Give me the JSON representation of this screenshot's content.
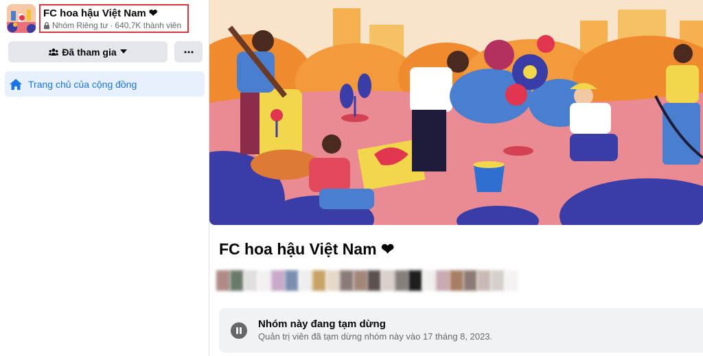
{
  "group": {
    "name": "FC hoa hậu Việt Nam ❤",
    "privacy": "Nhóm Riêng tư",
    "separator": "·",
    "members": "640,7K thành viên"
  },
  "actions": {
    "joined_label": "Đã tham gia",
    "more_label": "···"
  },
  "nav": {
    "home_label": "Trang chủ của cộng đồng"
  },
  "main": {
    "title": "FC hoa hậu Việt Nam ❤",
    "notice_title": "Nhóm này đang tạm dừng",
    "notice_desc": "Quản trị viên đã tạm dừng nhóm này vào 17 tháng 8, 2023."
  },
  "colors": {
    "accent": "#1b74e4",
    "highlight_border": "#d9343f",
    "button_bg": "#e4e6eb",
    "secondary_text": "#65676b"
  },
  "icons": [
    "group-thumbnail",
    "lock-icon",
    "people-icon",
    "caret-down-icon",
    "more-icon",
    "home-icon",
    "pause-icon"
  ]
}
